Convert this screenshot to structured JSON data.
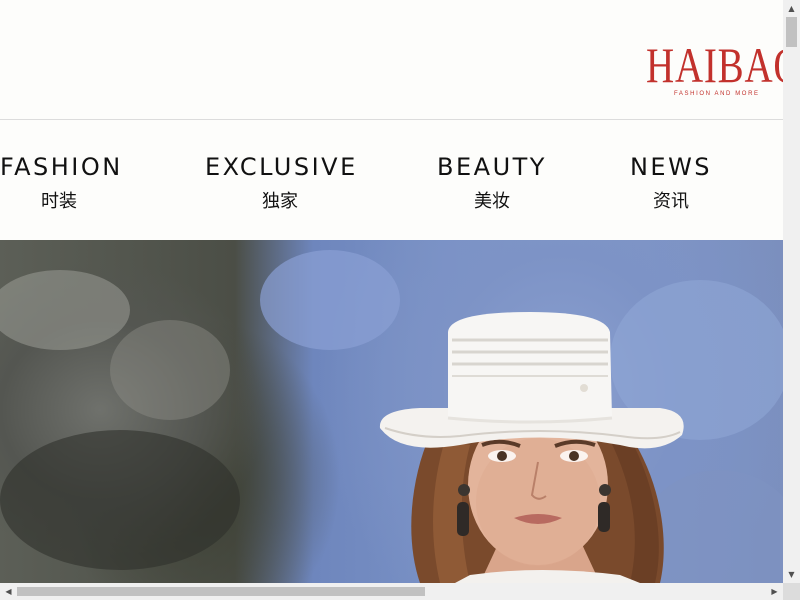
{
  "brand": {
    "logo_text": "HAIBAO",
    "tagline": "FASHION AND MORE",
    "color": "#c2312c"
  },
  "nav": {
    "items": [
      {
        "en": "FASHION",
        "zh": "时装"
      },
      {
        "en": "EXCLUSIVE",
        "zh": "独家"
      },
      {
        "en": "BEAUTY",
        "zh": "美妆"
      },
      {
        "en": "NEWS",
        "zh": "资讯"
      }
    ]
  },
  "scrollbars": {
    "up_icon": "triangle-up-icon",
    "down_icon": "triangle-down-icon",
    "left_icon": "triangle-left-icon",
    "right_icon": "triangle-right-icon"
  },
  "colors": {
    "text": "#111111",
    "background": "#fdfdfb"
  }
}
